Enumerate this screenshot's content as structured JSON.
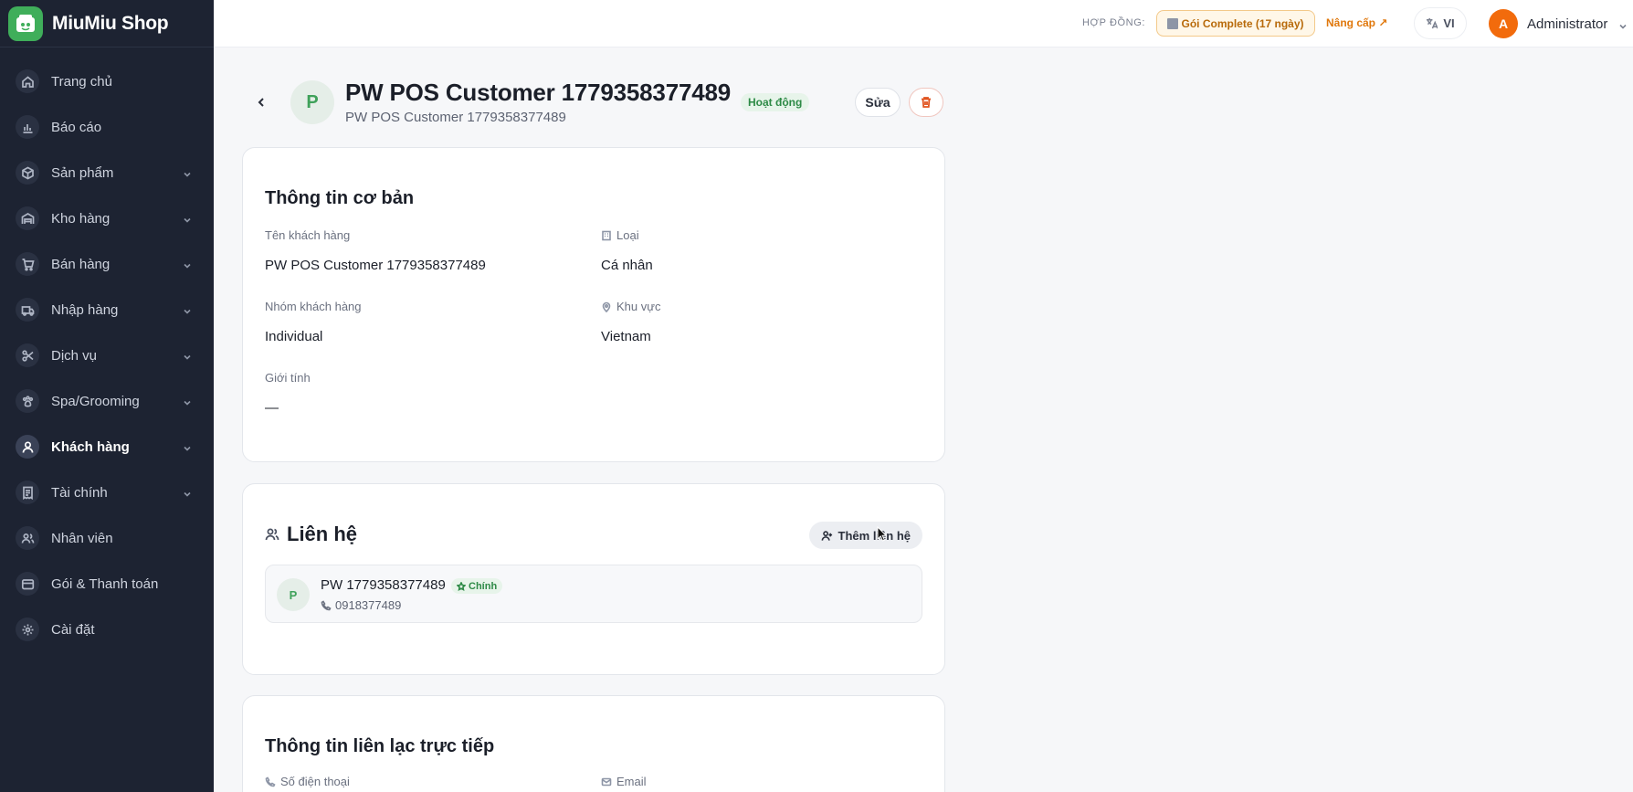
{
  "brand": {
    "name": "MiuMiu Shop"
  },
  "sidebar": {
    "items": [
      {
        "label": "Trang chủ",
        "icon": "home-icon",
        "expandable": false,
        "active": false
      },
      {
        "label": "Báo cáo",
        "icon": "bar-chart-icon",
        "expandable": false,
        "active": false
      },
      {
        "label": "Sản phẩm",
        "icon": "box-icon",
        "expandable": true,
        "active": false
      },
      {
        "label": "Kho hàng",
        "icon": "warehouse-icon",
        "expandable": true,
        "active": false
      },
      {
        "label": "Bán hàng",
        "icon": "cart-icon",
        "expandable": true,
        "active": false
      },
      {
        "label": "Nhập hàng",
        "icon": "truck-icon",
        "expandable": true,
        "active": false
      },
      {
        "label": "Dịch vụ",
        "icon": "scissors-icon",
        "expandable": true,
        "active": false
      },
      {
        "label": "Spa/Grooming",
        "icon": "paw-icon",
        "expandable": true,
        "active": false
      },
      {
        "label": "Khách hàng",
        "icon": "users-icon",
        "expandable": true,
        "active": true
      },
      {
        "label": "Tài chính",
        "icon": "receipt-icon",
        "expandable": true,
        "active": false
      },
      {
        "label": "Nhân viên",
        "icon": "user-group-icon",
        "expandable": false,
        "active": false
      },
      {
        "label": "Gói & Thanh toán",
        "icon": "wallet-icon",
        "expandable": false,
        "active": false
      },
      {
        "label": "Cài đặt",
        "icon": "gear-icon",
        "expandable": false,
        "active": false
      }
    ]
  },
  "topbar": {
    "contract_label": "HỢP ĐỒNG:",
    "plan_badge": "Gói Complete (17 ngày)",
    "upgrade_label": "Nâng cấp ↗",
    "language": "VI",
    "user_initial": "A",
    "user_name": "Administrator"
  },
  "customer": {
    "avatar_initial": "P",
    "title": "PW POS Customer 1779358377489",
    "subtitle": "PW POS Customer 1779358377489",
    "status": "Hoạt động",
    "edit_label": "Sửa"
  },
  "basic_info": {
    "title": "Thông tin cơ bản",
    "fields": [
      {
        "label": "Tên khách hàng",
        "value": "PW POS Customer 1779358377489",
        "icon": ""
      },
      {
        "label": "Loại",
        "value": "Cá nhân",
        "icon": "building-icon"
      },
      {
        "label": "Nhóm khách hàng",
        "value": "Individual",
        "icon": ""
      },
      {
        "label": "Khu vực",
        "value": "Vietnam",
        "icon": "map-pin-icon"
      },
      {
        "label": "Giới tính",
        "value": "—",
        "icon": ""
      }
    ]
  },
  "contacts": {
    "title": "Liên hệ",
    "add_label": "Thêm liên hệ",
    "items": [
      {
        "initial": "P",
        "name": "PW 1779358377489",
        "primary_label": "Chính",
        "phone": "0918377489"
      }
    ]
  },
  "direct_contact": {
    "title": "Thông tin liên lạc trực tiếp",
    "phone_label": "Số điện thoại",
    "email_label": "Email"
  },
  "colors": {
    "sidebar_bg": "#1d2332",
    "brand_green": "#3fae5a",
    "accent_orange": "#f26b0c",
    "status_green": "#2d8a46"
  }
}
